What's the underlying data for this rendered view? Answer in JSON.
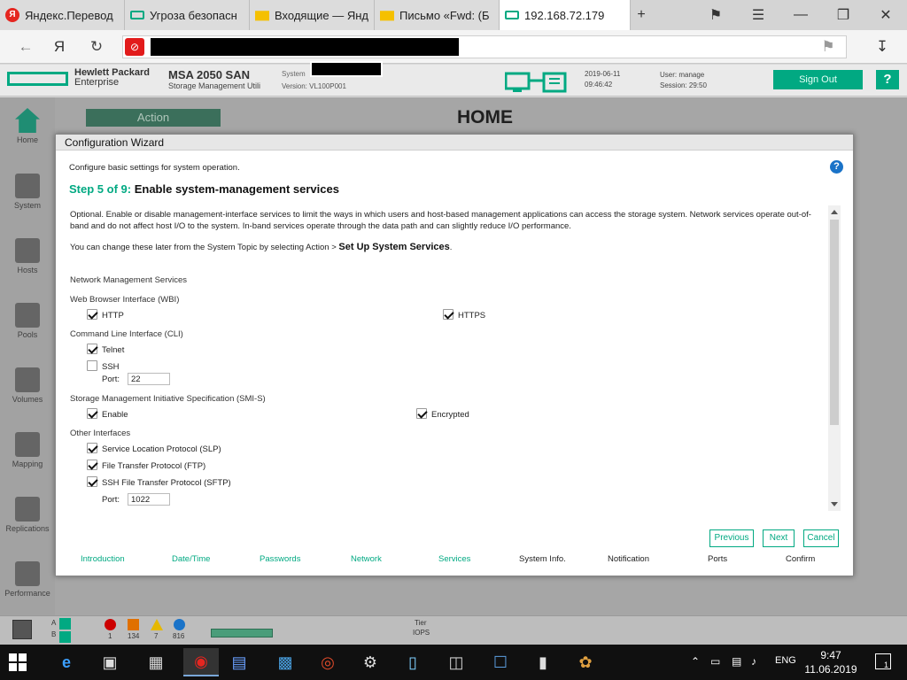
{
  "browser": {
    "tabs": [
      {
        "label": "Яндекс.Перевод",
        "icon": "yandex-icon"
      },
      {
        "label": "Угроза безопасн",
        "icon": "hpe-icon"
      },
      {
        "label": "Входящие — Янд",
        "icon": "mail-icon"
      },
      {
        "label": "Письмо «Fwd: (Б",
        "icon": "mail-icon"
      },
      {
        "label": "192.168.72.179",
        "icon": "hpe-icon",
        "active": true
      }
    ],
    "new_tab": "+",
    "ya_logo": "Я"
  },
  "app": {
    "brand_line1": "Hewlett Packard",
    "brand_line2": "Enterprise",
    "product": "MSA 2050 SAN",
    "product_sub": "Storage Management Utili",
    "system_label": "System",
    "version": "Version: VL100P001",
    "date": "2019-06-11",
    "time": "09:46:42",
    "user": "User: manage",
    "session": "Session: 29:50",
    "signout": "Sign Out",
    "help": "?"
  },
  "sidebar": {
    "items": [
      "Home",
      "System",
      "Hosts",
      "Pools",
      "Volumes",
      "Mapping",
      "Replications",
      "Performance"
    ]
  },
  "background": {
    "action": "Action",
    "home_title": "HOME"
  },
  "status": {
    "critical": "1",
    "error": "134",
    "warning": "7",
    "info": "816",
    "ctrl_a": "A",
    "ctrl_b": "B",
    "tier_label": "Tier",
    "iops_label": "IOPS"
  },
  "dialog": {
    "title": "Configuration Wizard",
    "description": "Configure basic settings for system operation.",
    "step_prefix": "Step 5 of 9:",
    "step_title": "Enable system-management services",
    "intro": "Optional. Enable or disable management-interface services to limit the ways in which users and host-based management applications can access the storage system. Network services operate out-of-band and do not affect host I/O to the system. In-band services operate through the data path and can slightly reduce I/O performance.",
    "later_text": "You can change these later from the System Topic by selecting Action >",
    "later_action": "Set Up System Services",
    "later_end": ".",
    "section_title": "Network Management Services",
    "wbi": {
      "label": "Web Browser Interface (WBI)",
      "http": "HTTP",
      "https": "HTTPS"
    },
    "cli": {
      "label": "Command Line Interface (CLI)",
      "telnet": "Telnet",
      "ssh": "SSH",
      "port_label": "Port:",
      "port_value": "22"
    },
    "smis": {
      "label": "Storage Management Initiative Specification (SMI-S)",
      "enable": "Enable",
      "encrypted": "Encrypted"
    },
    "other": {
      "label": "Other Interfaces",
      "slp": "Service Location Protocol (SLP)",
      "ftp": "File Transfer Protocol (FTP)",
      "sftp": "SSH File Transfer Protocol (SFTP)",
      "port_label": "Port:",
      "port_value": "1022"
    },
    "buttons": {
      "previous": "Previous",
      "next": "Next",
      "cancel": "Cancel"
    },
    "steps": [
      "Introduction",
      "Date/Time",
      "Passwords",
      "Network",
      "Services",
      "System Info.",
      "Notification",
      "Ports",
      "Confirm"
    ]
  },
  "taskbar": {
    "lang": "ENG",
    "time": "9:47",
    "date": "11.06.2019",
    "notif_count": "1"
  }
}
